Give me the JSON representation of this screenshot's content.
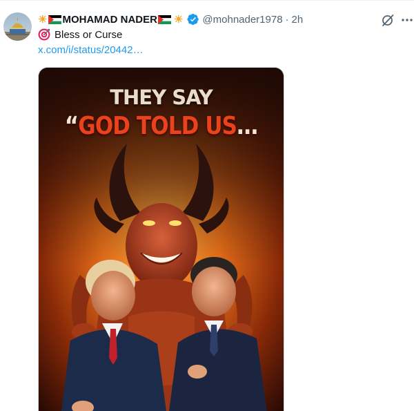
{
  "author": {
    "display_name": "MOHAMAD NADER",
    "handle": "@mohnader1978",
    "separator": "·",
    "time": "2h",
    "verified": true,
    "badge_color": "#1d9bf0"
  },
  "tweet": {
    "text": "Bless or Curse",
    "link": "x.com/i/status/20442…"
  },
  "media": {
    "headline_line1": "THEY SAY",
    "headline_quote": "“",
    "headline_line2": "GOD TOLD US",
    "headline_ellipsis": "…"
  },
  "icons": {
    "avatar": "dome-of-the-rock-avatar",
    "sun": "sun-emoji",
    "flag": "palestine-flag-emoji",
    "verified": "verified-badge-icon",
    "grok": "grok-icon",
    "more": "more-icon",
    "target": "target-emoji"
  },
  "colors": {
    "text_primary": "#0f1419",
    "text_secondary": "#536471",
    "link": "#1d9bf0",
    "headline_red": "#e8431c"
  }
}
